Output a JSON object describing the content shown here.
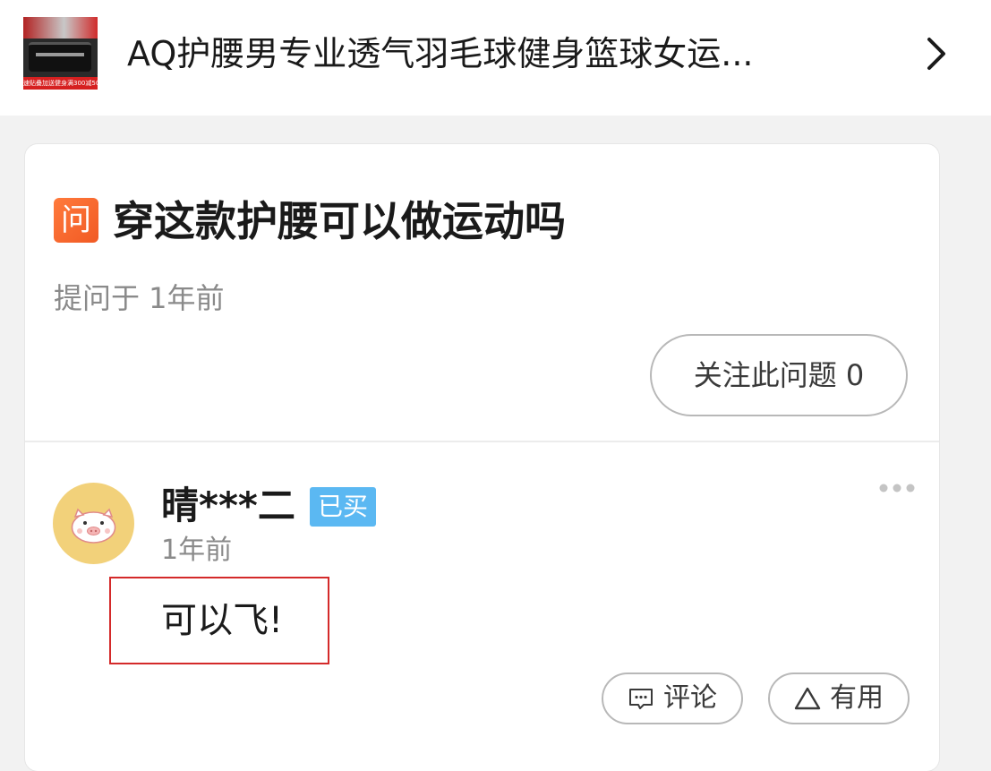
{
  "product": {
    "title": "AQ护腰男专业透气羽毛球健身篮球女运...",
    "thumb_promo": "速贴叠加送健身满300减50"
  },
  "question": {
    "icon_glyph": "问",
    "title": "穿这款护腰可以做运动吗",
    "asked_time": "提问于 1年前",
    "follow_label": "关注此问题 0"
  },
  "answer": {
    "user_name": "晴***二",
    "badge": "已买",
    "time": "1年前",
    "text": "可以飞!",
    "comment_label": "评论",
    "useful_label": "有用"
  },
  "colors": {
    "accent_orange": "#f15a24",
    "badge_blue": "#5bb8f2",
    "highlight_red": "#d42a2a",
    "avatar_yellow": "#f2d17a"
  }
}
